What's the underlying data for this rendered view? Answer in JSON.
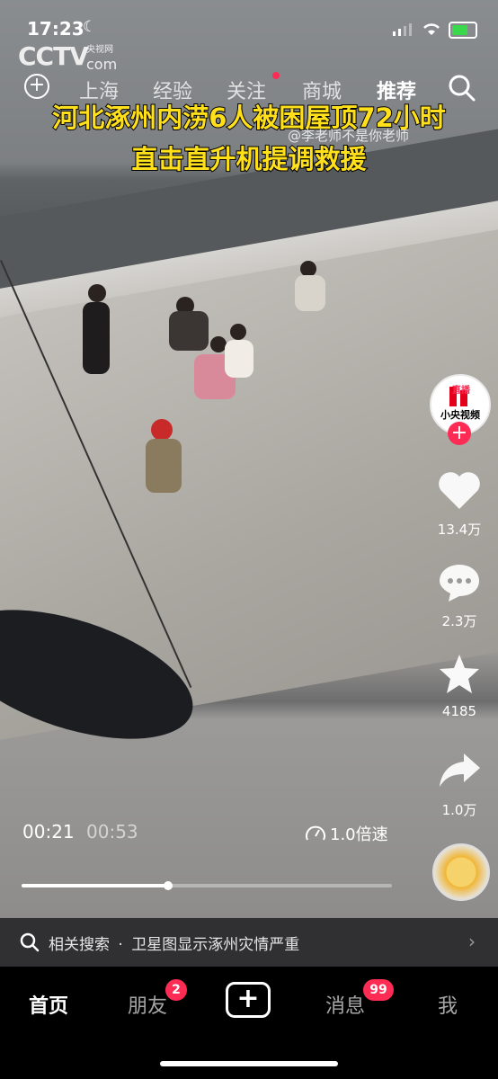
{
  "status_bar": {
    "time": "17:23",
    "moon_glyph": "☾",
    "wifi_glyph": "◉",
    "battery_level": 0.7
  },
  "watermark": {
    "logo": "CCTV",
    "sub": "央视网",
    "domain": "com"
  },
  "top_nav": {
    "tabs": [
      {
        "label": "上海",
        "active": false
      },
      {
        "label": "经验",
        "active": false
      },
      {
        "label": "关注",
        "active": false,
        "dot": true
      },
      {
        "label": "商城",
        "active": false
      },
      {
        "label": "推荐",
        "active": true
      }
    ]
  },
  "video": {
    "headline_line1": "河北涿州内涝6人被困屋顶72小时",
    "headline_line2": "直击直升机提调救援",
    "author_handle": "@李老师不是你老师"
  },
  "side_actions": {
    "avatar_live_label": "直播",
    "avatar_name": "小央视频",
    "follow_plus": "+",
    "like_count": "13.4万",
    "comment_count": "2.3万",
    "favorite_count": "4185",
    "share_count": "1.0万"
  },
  "playback": {
    "current_time": "00:21",
    "total_time": "00:53",
    "speed_label": "1.0倍速",
    "progress": 0.396
  },
  "related_search": {
    "prefix": "相关搜索",
    "separator": "·",
    "query": "卫星图显示涿州灾情严重",
    "arrow": "›"
  },
  "bottom_tabs": [
    {
      "label": "首页",
      "active": true
    },
    {
      "label": "朋友",
      "active": false,
      "badge": "2"
    },
    {
      "label": "+",
      "active": false
    },
    {
      "label": "消息",
      "active": false,
      "badge": "99"
    },
    {
      "label": "我",
      "active": false
    }
  ],
  "colors": {
    "accent": "#fe2c55",
    "headline": "#ffe01a"
  }
}
